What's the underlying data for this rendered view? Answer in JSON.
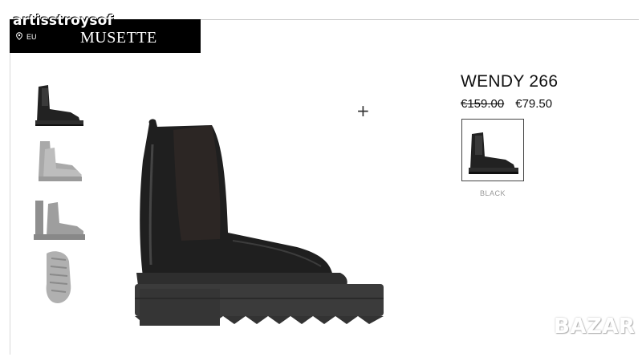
{
  "watermark": "artisstroysof",
  "header": {
    "region": "EU",
    "brand": "MUSETTE"
  },
  "product": {
    "name": "WENDY 266",
    "old_price": "€159.00",
    "new_price": "€79.50",
    "color_label": "BLACK"
  },
  "zoom_symbol": "+",
  "footer_logo": "BAZAR",
  "icons": [
    "location-pin-icon",
    "zoom-plus-icon"
  ],
  "colors": {
    "header_bg": "#000000",
    "boot": "#1c1c1c",
    "sole": "#3a3a3a"
  }
}
